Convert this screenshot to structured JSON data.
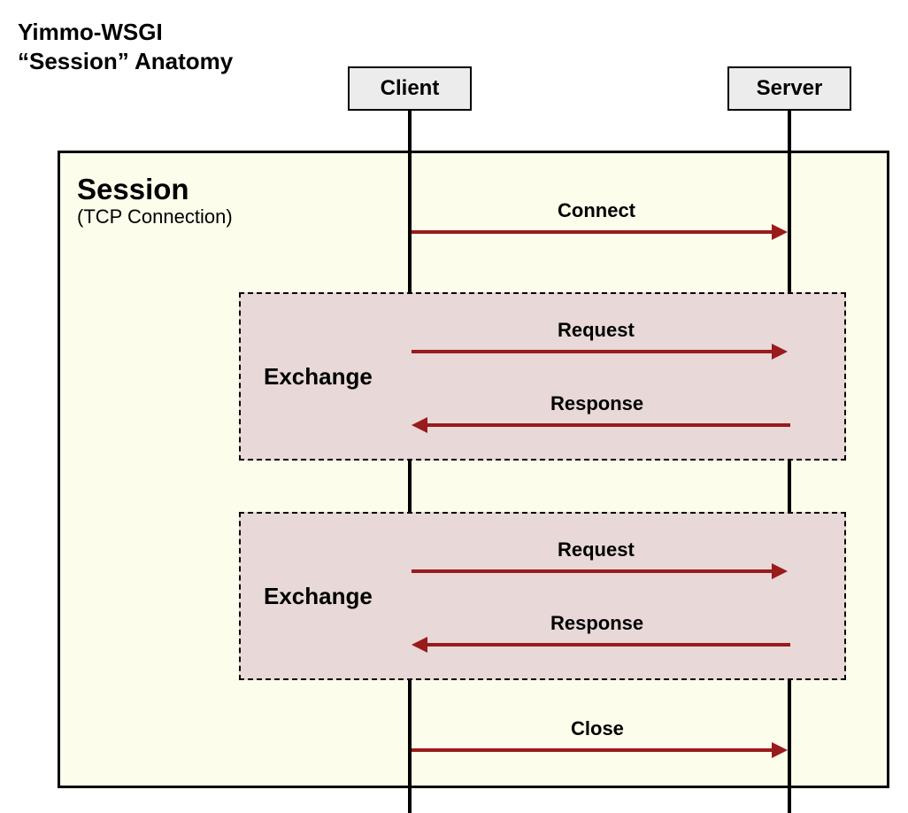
{
  "title": {
    "line1": "Yimmo-WSGI",
    "line2": "“Session” Anatomy"
  },
  "participants": {
    "client": "Client",
    "server": "Server"
  },
  "session": {
    "title": "Session",
    "subtitle": "(TCP Connection)"
  },
  "exchanges": [
    {
      "label": "Exchange",
      "request": "Request",
      "response": "Response"
    },
    {
      "label": "Exchange",
      "request": "Request",
      "response": "Response"
    }
  ],
  "messages": {
    "connect": "Connect",
    "close": "Close"
  }
}
